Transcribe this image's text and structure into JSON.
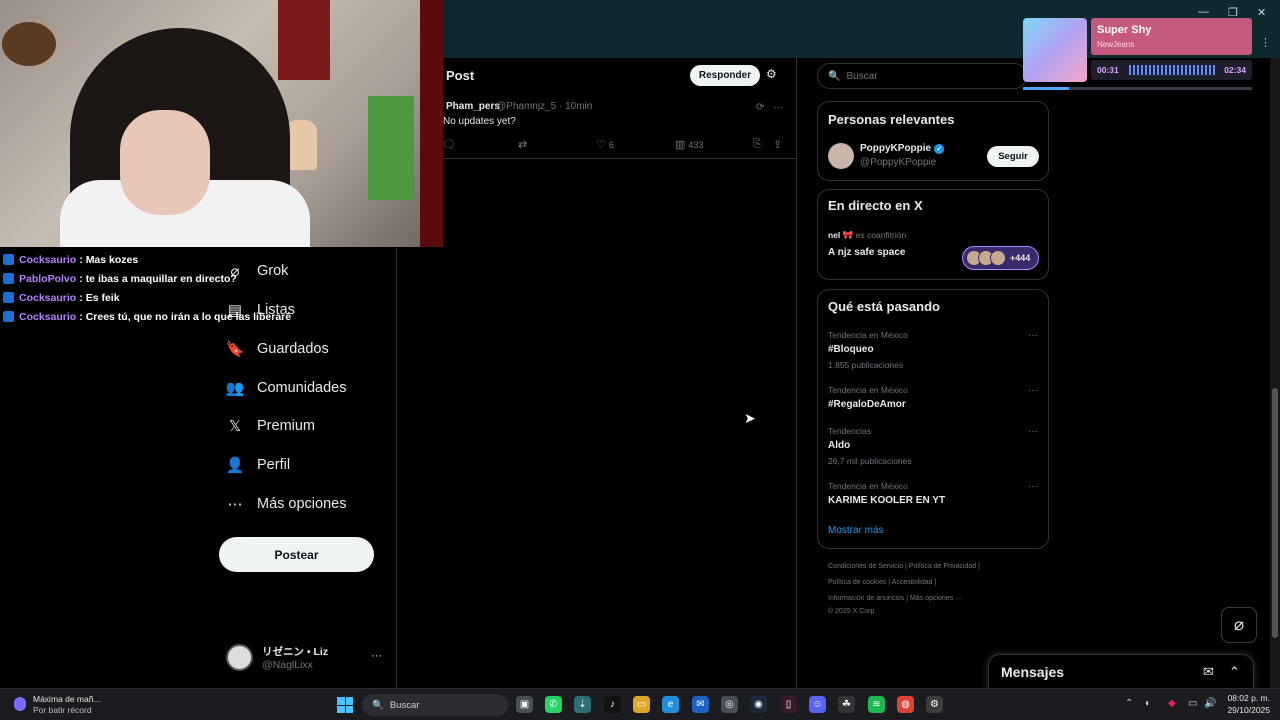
{
  "window": {
    "minimize": "—",
    "maximize": "❐",
    "close": "✕"
  },
  "chat": [
    {
      "user": "Cocksaurio",
      "sep": ":",
      "message": "Mas kozes"
    },
    {
      "user": "PabloPolvo",
      "sep": ":",
      "message": "te ibas a maquillar en directo?"
    },
    {
      "user": "Cocksaurio",
      "sep": ":",
      "message": "Es feik"
    },
    {
      "user": "Cocksaurio",
      "sep": ":",
      "message": "Crees tú, que no irán a lo que las liberaré"
    }
  ],
  "nav": {
    "items": [
      {
        "label": "Grok",
        "icon": "grok-icon",
        "glyph": "⌀"
      },
      {
        "label": "Listas",
        "icon": "list-icon",
        "glyph": "▤"
      },
      {
        "label": "Guardados",
        "icon": "bookmark-icon",
        "glyph": "🔖"
      },
      {
        "label": "Comunidades",
        "icon": "communities-icon",
        "glyph": "👥"
      },
      {
        "label": "Premium",
        "icon": "x-logo-icon",
        "glyph": "𝕏"
      },
      {
        "label": "Perfil",
        "icon": "person-icon",
        "glyph": "👤"
      },
      {
        "label": "Más opciones",
        "icon": "more-circle-icon",
        "glyph": "⋯"
      }
    ],
    "post_button": "Postear",
    "profile": {
      "name": "リゼニン • Liz",
      "handle": "@NaglLixx",
      "more": "···"
    }
  },
  "post": {
    "title": "Post",
    "reply_button": "Responder",
    "tweet": {
      "name": "Pham_pers",
      "handle": "@Phamnjz_5 · 10min",
      "text": "No updates yet?",
      "likes": "6",
      "views": "433"
    }
  },
  "sidebar": {
    "search_placeholder": "Buscar",
    "relevant": {
      "title": "Personas relevantes",
      "name": "PoppyKPoppie",
      "handle": "@PoppyKPoppie",
      "follow": "Seguir"
    },
    "live": {
      "title": "En directo en X",
      "host": "nel 🎀",
      "host_role": "es coanfitrión",
      "space_title": "A njz safe space",
      "listeners": "+444"
    },
    "trends": {
      "title": "Qué está pasando",
      "items": [
        {
          "context": "Tendencia en México",
          "name": "#Bloqueo",
          "count": "1.855 publicaciones"
        },
        {
          "context": "Tendencia en México",
          "name": "#RegaloDeAmor",
          "count": ""
        },
        {
          "context": "Tendencias",
          "name": "Aldo",
          "count": "26,7 mil publicaciones"
        },
        {
          "context": "Tendencia en México",
          "name": "KARIME KOOLER EN YT",
          "count": ""
        }
      ],
      "show_more": "Mostrar más"
    },
    "footer": [
      "Condiciones de Servicio  |   Política de Privacidad  |",
      "Política de cookies  |   Accesibilidad  |",
      "Información de anuncios  |   Más opciones ···",
      "© 2025 X Corp."
    ]
  },
  "music": {
    "title": "Super Shy",
    "artist": "NewJeans",
    "elapsed": "00:31",
    "duration": "02:34",
    "progress": 0.2
  },
  "messages": {
    "title": "Mensajes"
  },
  "taskbar": {
    "weather_title": "Máxima de mañ...",
    "weather_sub": "Por batir récord",
    "search": "Buscar",
    "time": "08:02 p. m.",
    "date": "29/10/2025"
  }
}
